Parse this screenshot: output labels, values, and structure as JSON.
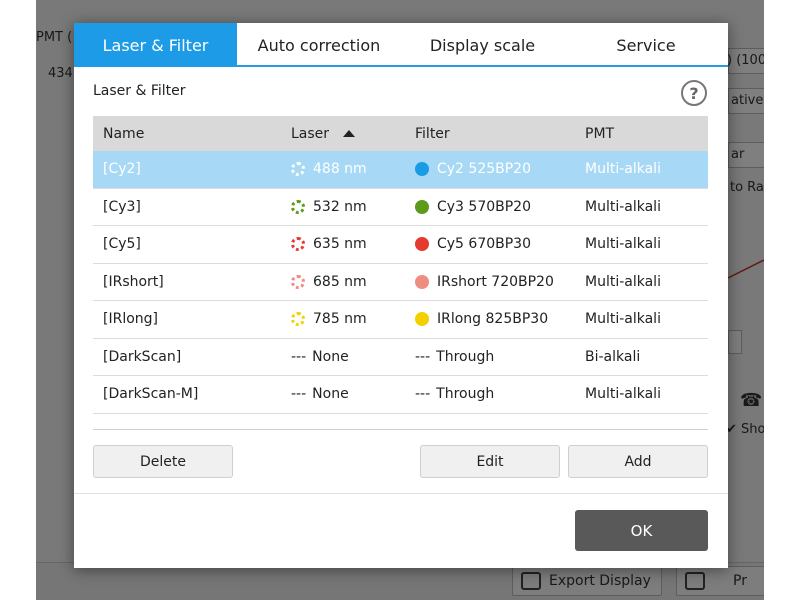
{
  "background": {
    "pmt_label": "PMT (",
    "pmt_value": "434",
    "right_field_1": ") (100",
    "right_field_2": "ative",
    "right_field_3": "ar",
    "right_field_4": "to Ra",
    "right_field_5": "Sho",
    "export_label": "Export Display",
    "print_label": "Pr"
  },
  "dialog": {
    "tabs": [
      {
        "label": "Laser & Filter",
        "active": true
      },
      {
        "label": "Auto correction",
        "active": false
      },
      {
        "label": "Display scale",
        "active": false
      },
      {
        "label": "Service",
        "active": false
      }
    ],
    "section_title": "Laser & Filter",
    "help_icon": "?",
    "table": {
      "headers": {
        "name": "Name",
        "laser": "Laser",
        "filter": "Filter",
        "pmt": "PMT"
      },
      "sort_column": "Laser",
      "sort_direction": "ascending",
      "rows": [
        {
          "name": "[Cy2]",
          "laser": "488 nm",
          "laser_color": "#ffffff",
          "filter": "Cy2 525BP20",
          "filter_color": "#1a9be6",
          "pmt": "Multi-alkali",
          "selected": true
        },
        {
          "name": "[Cy3]",
          "laser": "532 nm",
          "laser_color": "#5d9a1a",
          "filter": "Cy3 570BP20",
          "filter_color": "#5d9a1a",
          "pmt": "Multi-alkali",
          "selected": false
        },
        {
          "name": "[Cy5]",
          "laser": "635 nm",
          "laser_color": "#e53a2e",
          "filter": "Cy5 670BP30",
          "filter_color": "#e53a2e",
          "pmt": "Multi-alkali",
          "selected": false
        },
        {
          "name": "[IRshort]",
          "laser": "685 nm",
          "laser_color": "#ef8e80",
          "filter": "IRshort 720BP20",
          "filter_color": "#ef8e80",
          "pmt": "Multi-alkali",
          "selected": false
        },
        {
          "name": "[IRlong]",
          "laser": "785 nm",
          "laser_color": "#f5d000",
          "filter": "IRlong 825BP30",
          "filter_color": "#f5d000",
          "pmt": "Multi-alkali",
          "selected": false
        },
        {
          "name": "[DarkScan]",
          "laser": "None",
          "filter": "Through",
          "pmt": "Bi-alkali",
          "selected": false
        },
        {
          "name": "[DarkScan-M]",
          "laser": "None",
          "filter": "Through",
          "pmt": "Multi-alkali",
          "selected": false
        }
      ]
    },
    "buttons": {
      "delete": "Delete",
      "edit": "Edit",
      "add": "Add",
      "ok": "OK"
    },
    "dash_glyph": "---"
  }
}
